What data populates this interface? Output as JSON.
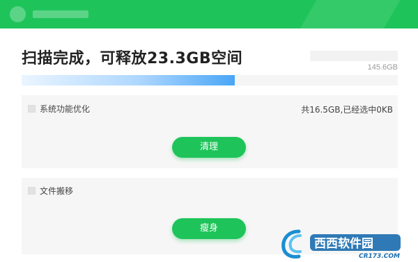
{
  "header": {
    "headline": "扫描完成，可释放23.3GB空间",
    "total_size": "145.6GB",
    "progress_fraction": 0.567
  },
  "cards": [
    {
      "title": "系统功能优化",
      "status": "共16.5GB,已经选中0KB",
      "button_label": "清理"
    },
    {
      "title": "文件搬移",
      "button_label": "瘦身"
    }
  ],
  "watermark": {
    "text": "西西软件园",
    "url_text": "CR173.COM"
  },
  "colors": {
    "brand_green": "#1ec45a",
    "progress_blue": "#4aa6f5"
  }
}
